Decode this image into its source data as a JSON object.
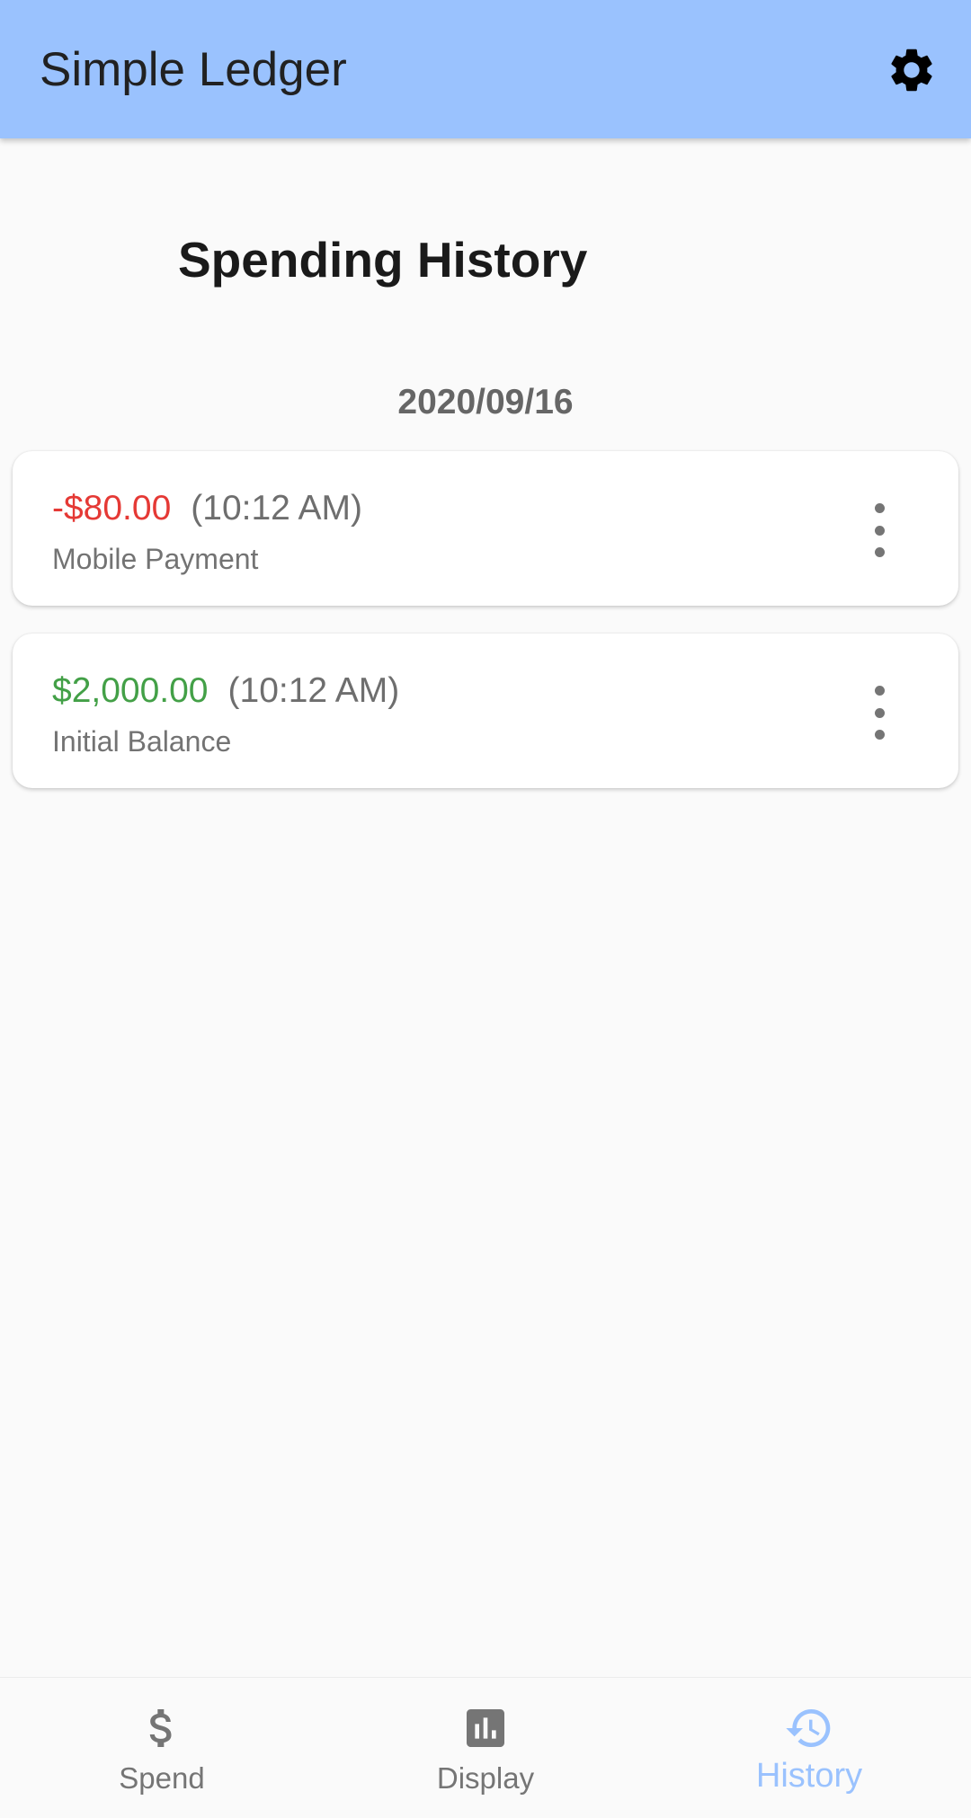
{
  "app_bar": {
    "title": "Simple Ledger",
    "settings_icon": "gear-icon",
    "background_color": "#9ac2fe"
  },
  "page": {
    "title": "Spending History"
  },
  "history": {
    "date": "2020/09/16",
    "entries": [
      {
        "amount": "-$80.00",
        "time": "(10:12 AM)",
        "description": "Mobile Payment",
        "amount_color": "#e53935",
        "menu_icon": "more-vert-icon"
      },
      {
        "amount": "$2,000.00",
        "time": "(10:12 AM)",
        "description": "Initial Balance",
        "amount_color": "#43a047",
        "menu_icon": "more-vert-icon"
      }
    ]
  },
  "bottom_nav": {
    "active": "History",
    "active_color": "#9ac2fe",
    "items": [
      {
        "label": "Spend",
        "icon": "dollar-icon"
      },
      {
        "label": "Display",
        "icon": "bar-chart-icon"
      },
      {
        "label": "History",
        "icon": "history-icon"
      }
    ]
  }
}
